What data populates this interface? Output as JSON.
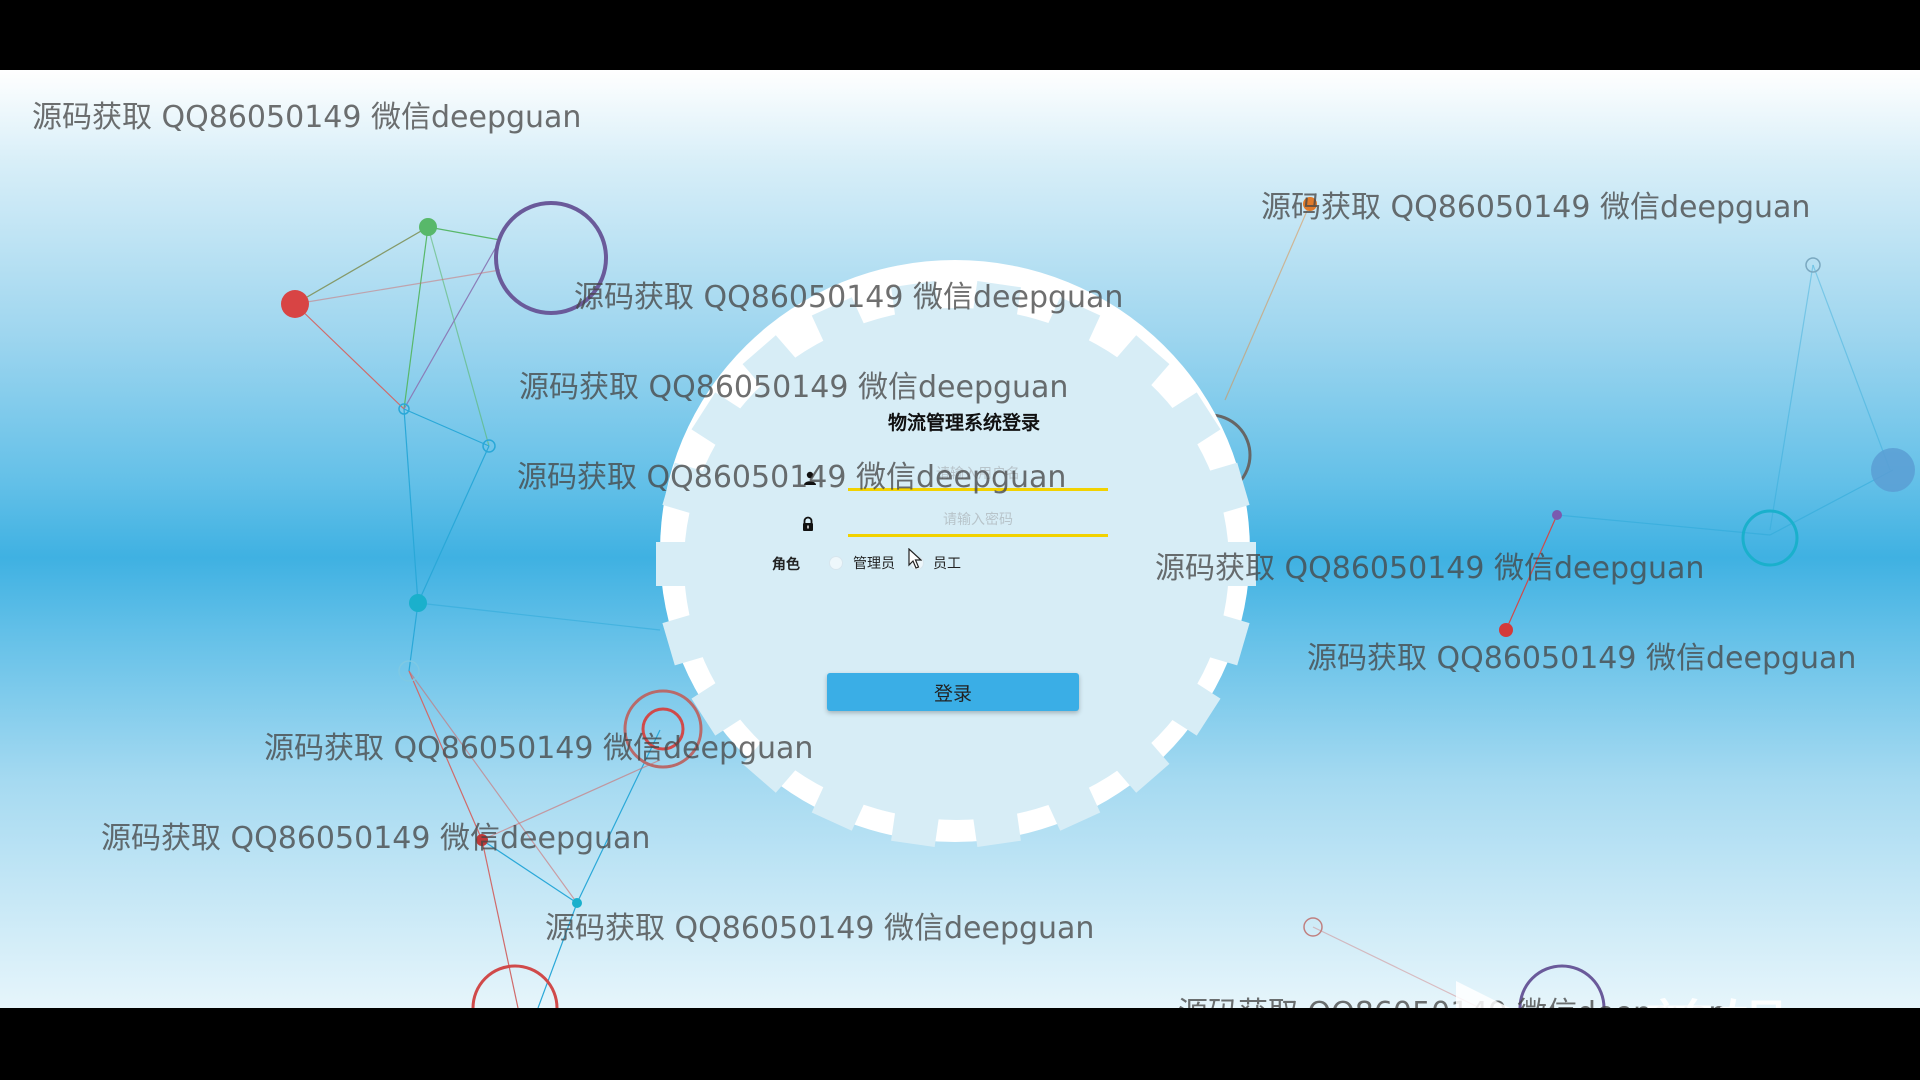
{
  "login": {
    "title": "物流管理系统登录",
    "username_placeholder": "请输入用户名",
    "password_placeholder": "请输入密码",
    "role_label": "角色",
    "role_options": [
      "管理员",
      "员工"
    ],
    "submit_label": "登录"
  },
  "watermark_text": "源码获取 QQ86050149 微信deepguan",
  "editor_logo": "ev剪辑",
  "icons": {
    "user": "user-icon",
    "lock": "lock-icon",
    "cursor": "mouse-cursor-icon",
    "logo": "ev-play-logo-icon"
  },
  "colors": {
    "accent_button": "#3aaee6",
    "input_underline": "#f2d200",
    "background_blue": "#3fb1e2",
    "gear_fill": "#d7edf6"
  }
}
